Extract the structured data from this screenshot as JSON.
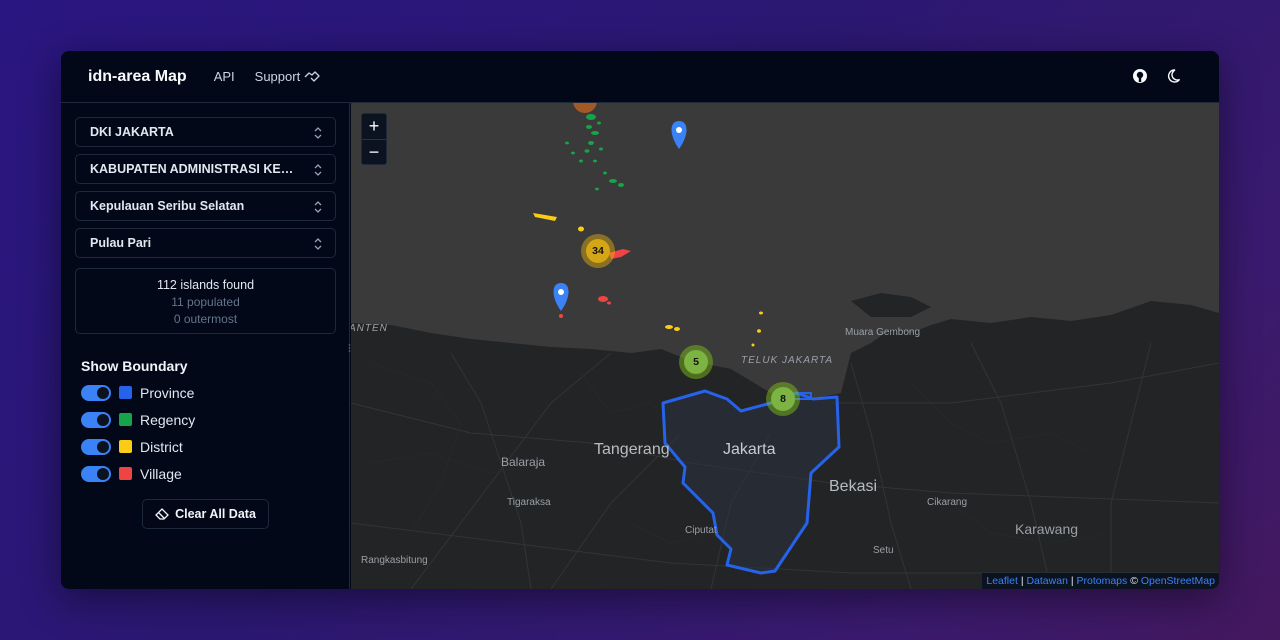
{
  "header": {
    "brand": "idn-area Map",
    "nav": [
      {
        "label": "API"
      },
      {
        "label": "Support"
      }
    ]
  },
  "sidebar": {
    "selects": [
      {
        "value": "DKI JAKARTA"
      },
      {
        "value": "KABUPATEN ADMINISTRASI KEPULAUAN SERIBU"
      },
      {
        "value": "Kepulauan Seribu Selatan"
      },
      {
        "value": "Pulau Pari"
      }
    ],
    "stats": {
      "found": "112 islands found",
      "populated": "11 populated",
      "outermost": "0 outermost"
    },
    "boundary_title": "Show Boundary",
    "boundaries": [
      {
        "label": "Province",
        "color": "#2563eb",
        "on": true
      },
      {
        "label": "Regency",
        "color": "#16a34a",
        "on": true
      },
      {
        "label": "District",
        "color": "#facc15",
        "on": true
      },
      {
        "label": "Village",
        "color": "#ef4444",
        "on": true
      }
    ],
    "clear_label": "Clear All Data"
  },
  "map": {
    "zoom_in": "+",
    "zoom_out": "−",
    "clusters": [
      {
        "count": "34"
      },
      {
        "count": "5"
      },
      {
        "count": "8"
      }
    ],
    "labels": {
      "banten": "ANTEN",
      "muara_gembong": "Muara Gembong",
      "teluk_jakarta": "TELUK JAKARTA",
      "tangerang": "Tangerang",
      "jakarta": "Jakarta",
      "balaraja": "Balaraja",
      "bekasi": "Bekasi",
      "tigaraksa": "Tigaraksa",
      "cikarang": "Cikarang",
      "karawang": "Karawang",
      "ciputat": "Ciputat",
      "setu": "Setu",
      "rangkasbitung": "Rangkasbitung"
    },
    "attribution": {
      "leaflet": "Leaflet",
      "datawan": "Datawan",
      "protomaps": "Protomaps",
      "copy": "©",
      "osm": "OpenStreetMap"
    }
  },
  "icons": {
    "github": "github-icon",
    "theme": "moon-icon",
    "support": "handshake-icon",
    "chevron": "chevron-up-down-icon",
    "eraser": "eraser-icon",
    "pin": "map-pin-icon"
  }
}
